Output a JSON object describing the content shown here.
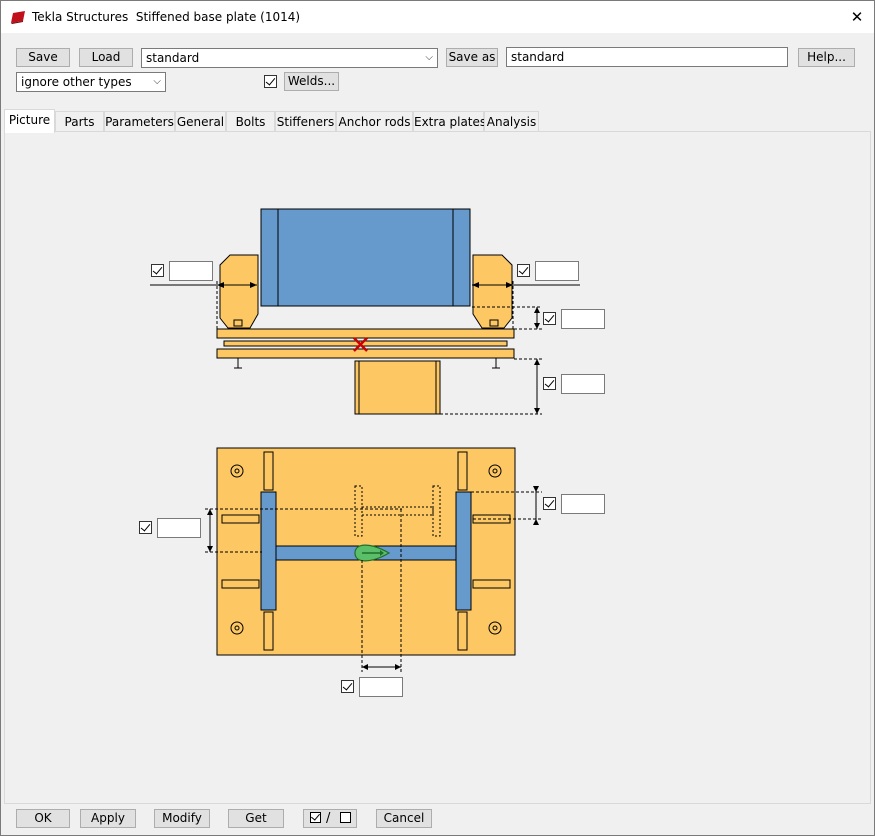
{
  "window": {
    "title": "Tekla Structures  Stiffened base plate (1014)"
  },
  "toolbar": {
    "save_label": "Save",
    "load_label": "Load",
    "preset_value": "standard",
    "save_as_label": "Save as",
    "save_as_value": "standard",
    "help_label": "Help...",
    "filter_value": "ignore other types",
    "welds_label": "Welds..."
  },
  "tabs": [
    "Picture",
    "Parts",
    "Parameters",
    "General",
    "Bolts",
    "Stiffeners",
    "Anchor rods",
    "Extra plates",
    "Analysis"
  ],
  "active_tab": "Picture",
  "footer": {
    "ok_label": "OK",
    "apply_label": "Apply",
    "modify_label": "Modify",
    "get_label": "Get",
    "toggle_slash": "/",
    "cancel_label": "Cancel"
  },
  "colors": {
    "plate": "#FDC863",
    "profile": "#6699CC",
    "accent_red": "#CC0000",
    "marker_green": "#2E8B3A"
  },
  "icons": [
    "tekla-app-icon",
    "close-icon",
    "dropdown-arrow-icon",
    "checkbox-checked-icon",
    "position-cross-icon",
    "origin-marker-icon"
  ]
}
